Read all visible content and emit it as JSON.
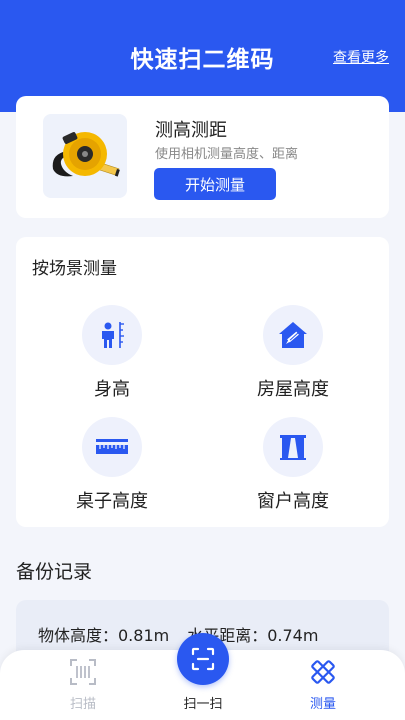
{
  "header": {
    "title": "快速扫二维码",
    "more_label": "查看更多"
  },
  "measure_card": {
    "title": "测高测距",
    "subtitle": "使用相机测量高度、距离",
    "button_label": "开始测量"
  },
  "scenes": {
    "title": "按场景测量",
    "items": [
      {
        "label": "身高",
        "icon": "person-height-icon"
      },
      {
        "label": "房屋高度",
        "icon": "house-height-icon"
      },
      {
        "label": "桌子高度",
        "icon": "table-height-icon"
      },
      {
        "label": "窗户高度",
        "icon": "window-height-icon"
      }
    ]
  },
  "backup": {
    "title": "备份记录",
    "record": {
      "object_height": "物体高度：0.81m",
      "horizontal_distance": "水平距离：0.74m"
    }
  },
  "tabbar": {
    "tabs": [
      {
        "label": "扫描",
        "icon": "barcode-scan-icon",
        "active": false
      },
      {
        "label": "扫一扫",
        "icon": "scan-frame-icon",
        "active": false
      },
      {
        "label": "测量",
        "icon": "ruler-measure-icon",
        "active": true
      }
    ]
  },
  "colors": {
    "accent": "#2a58f0",
    "background": "#f3f5fb",
    "tab_inactive": "#b8bcc6"
  }
}
